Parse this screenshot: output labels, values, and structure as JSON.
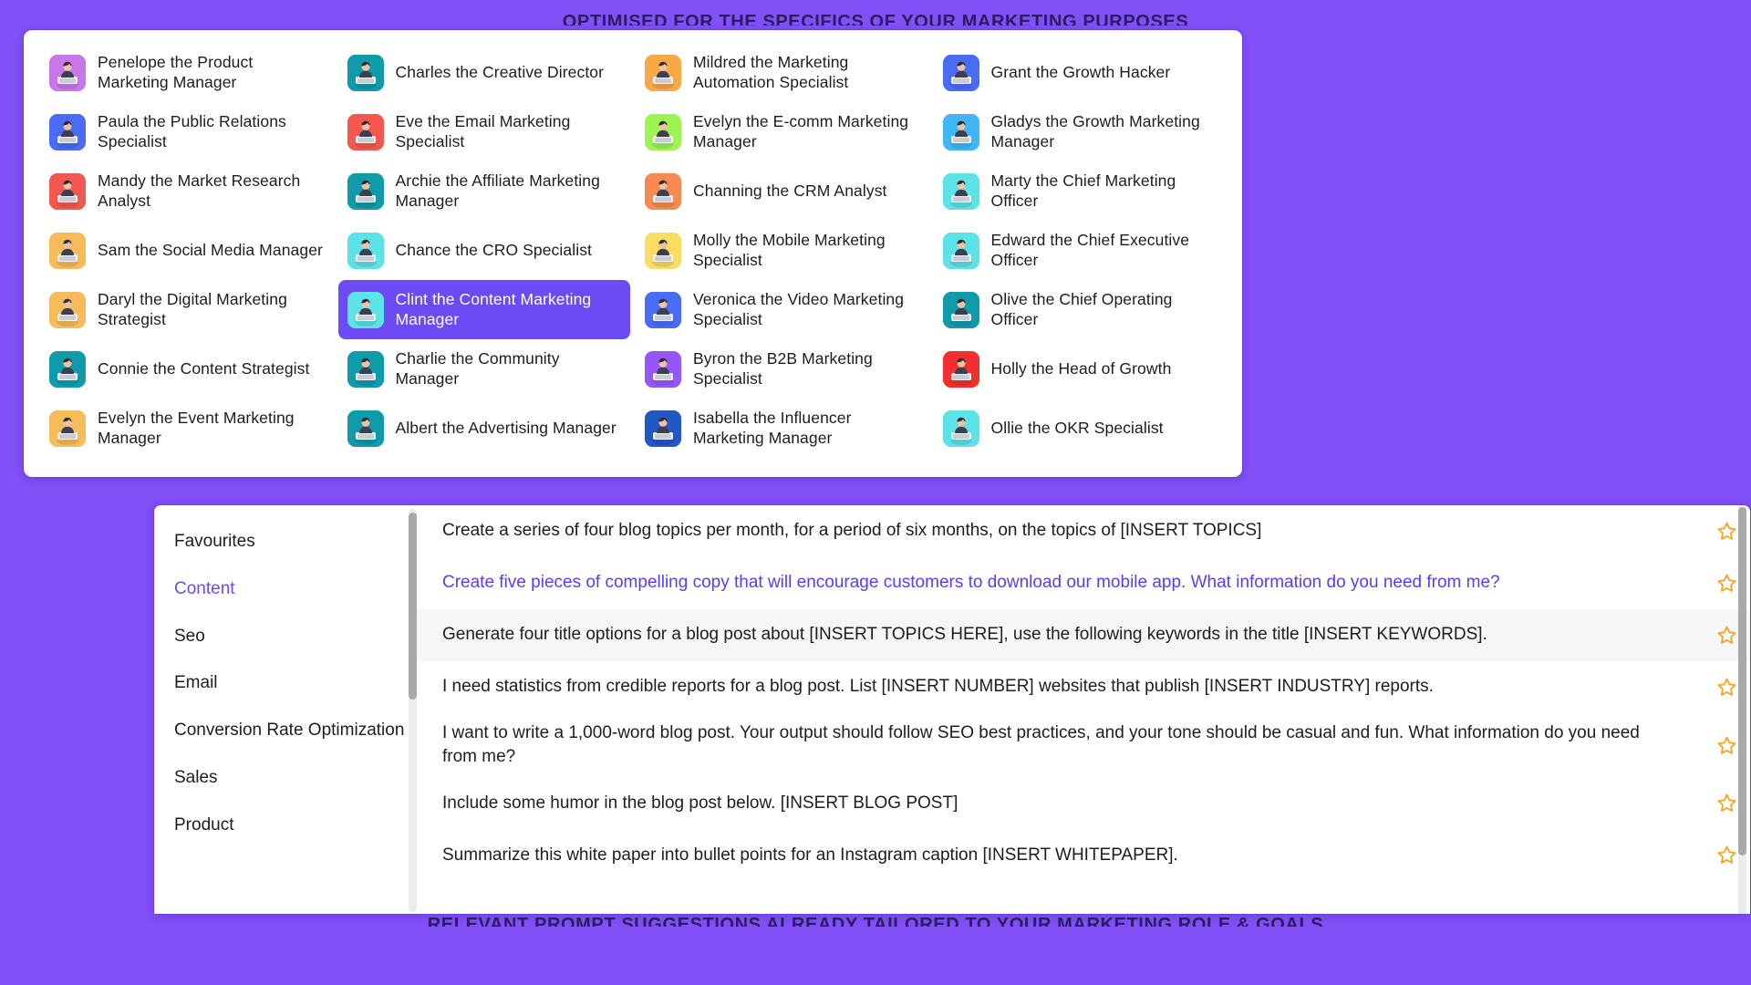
{
  "page": {
    "background_color": "#8250F7",
    "accent_color": "#6C4BF4",
    "star_color": "#F5A623",
    "headline_top": "OPTIMISED FOR THE SPECIFICS OF YOUR MARKETING PURPOSES",
    "headline_bottom": "RELEVANT PROMPT SUGGESTIONS ALREADY TAILORED TO YOUR MARKETING ROLE & GOALS"
  },
  "persona_card": {
    "selected": "Clint the Content Marketing Manager",
    "columns": [
      {
        "items": [
          {
            "label": "Penelope the Product Marketing Manager",
            "avatar": "avatar-female-laptop",
            "color": "#C977E8",
            "selected": false
          },
          {
            "label": "Paula the Public Relations Specialist",
            "avatar": "avatar-female-desk",
            "color": "#4A6CF5",
            "selected": false
          },
          {
            "label": "Mandy the Market Research Analyst",
            "avatar": "avatar-female-phone",
            "color": "#F4574F",
            "selected": false
          },
          {
            "label": "Sam the Social Media Manager",
            "avatar": "avatar-male-laptop",
            "color": "#F8BB5C",
            "selected": false
          },
          {
            "label": "Daryl the Digital Marketing Strategist",
            "avatar": "avatar-male-desk",
            "color": "#F8BB5C",
            "selected": false
          },
          {
            "label": "Connie the Content Strategist",
            "avatar": "avatar-female-board",
            "color": "#0F9BAA",
            "selected": false
          },
          {
            "label": "Evelyn the Event Marketing Manager",
            "avatar": "avatar-female-event",
            "color": "#F8BB5C",
            "selected": false
          }
        ]
      },
      {
        "items": [
          {
            "label": "Charles the Creative Director",
            "avatar": "avatar-male-table",
            "color": "#0F9BAA",
            "selected": false
          },
          {
            "label": "Eve the Email Marketing Specialist",
            "avatar": "avatar-female-email",
            "color": "#F4574F",
            "selected": false
          },
          {
            "label": "Archie the Affiliate Marketing Manager",
            "avatar": "avatar-male-suit",
            "color": "#0F9BAA",
            "selected": false
          },
          {
            "label": "Chance the CRO Specialist",
            "avatar": "avatar-person-sitting",
            "color": "#5BE3E8",
            "selected": false
          },
          {
            "label": "Clint the Content Marketing Manager",
            "avatar": "avatar-presenter",
            "color": "#5BE3E8",
            "selected": true
          },
          {
            "label": "Charlie the Community Manager",
            "avatar": "avatar-male-community",
            "color": "#0F9BAA",
            "selected": false
          },
          {
            "label": "Albert the Advertising Manager",
            "avatar": "avatar-male-ads",
            "color": "#0F9BAA",
            "selected": false
          }
        ]
      },
      {
        "items": [
          {
            "label": "Mildred the Marketing Automation Specialist",
            "avatar": "avatar-female-dashboard",
            "color": "#F7A948",
            "selected": false
          },
          {
            "label": "Evelyn the E-comm Marketing Manager",
            "avatar": "avatar-female-ecomm",
            "color": "#9CF553",
            "selected": false
          },
          {
            "label": "Channing the CRM Analyst",
            "avatar": "avatar-male-crm",
            "color": "#F58B52",
            "selected": false
          },
          {
            "label": "Molly the Mobile Marketing Specialist",
            "avatar": "avatar-female-mobile",
            "color": "#FBDC65",
            "selected": false
          },
          {
            "label": "Veronica the Video Marketing Specialist",
            "avatar": "avatar-female-video",
            "color": "#4A6CF5",
            "selected": false
          },
          {
            "label": "Byron the B2B Marketing Specialist",
            "avatar": "avatar-male-b2b",
            "color": "#9456F5",
            "selected": false
          },
          {
            "label": "Isabella the Influencer Marketing Manager",
            "avatar": "avatar-female-influencer",
            "color": "#2258C4",
            "selected": false
          }
        ]
      },
      {
        "items": [
          {
            "label": "Grant the Growth Hacker",
            "avatar": "avatar-hacker",
            "color": "#4A6CF5",
            "selected": false
          },
          {
            "label": "Gladys the Growth Marketing Manager",
            "avatar": "avatar-female-growth",
            "color": "#3FB6F5",
            "selected": false
          },
          {
            "label": "Marty the Chief Marketing Officer",
            "avatar": "avatar-male-cheer",
            "color": "#5BE3E8",
            "selected": false
          },
          {
            "label": "Edward the Chief Executive Officer",
            "avatar": "avatar-ceo-podium",
            "color": "#5BE3E8",
            "selected": false
          },
          {
            "label": "Olive the Chief Operating Officer",
            "avatar": "avatar-female-coo",
            "color": "#0F9BAA",
            "selected": false
          },
          {
            "label": "Holly the Head of Growth",
            "avatar": "avatar-female-growth-wall",
            "color": "#F22E2E",
            "selected": false
          },
          {
            "label": "Ollie the OKR Specialist",
            "avatar": "avatar-okr-desk",
            "color": "#5BE3E8",
            "selected": false
          }
        ]
      }
    ]
  },
  "prompt_panel": {
    "categories": [
      {
        "label": "Favourites",
        "active": false
      },
      {
        "label": "Content",
        "active": true
      },
      {
        "label": "Seo",
        "active": false
      },
      {
        "label": "Email",
        "active": false
      },
      {
        "label": "Conversion Rate Optimization",
        "active": false
      },
      {
        "label": "Sales",
        "active": false
      },
      {
        "label": "Product",
        "active": false
      }
    ],
    "prompts": [
      {
        "text": "Create a series of four blog topics per month, for a period of six months, on the topics of [INSERT TOPICS]",
        "highlight": false,
        "hovered": false,
        "starred": false
      },
      {
        "text": "Create five pieces of compelling copy that will encourage customers to download our mobile app. What information do you need from me?",
        "highlight": true,
        "hovered": false,
        "starred": false
      },
      {
        "text": "Generate four title options for a blog post about [INSERT TOPICS HERE], use the following keywords in the title [INSERT KEYWORDS].",
        "highlight": false,
        "hovered": true,
        "starred": false
      },
      {
        "text": "I need statistics from credible reports for a blog post. List [INSERT NUMBER] websites that publish [INSERT INDUSTRY] reports.",
        "highlight": false,
        "hovered": false,
        "starred": false
      },
      {
        "text": "I want to write a 1,000-word blog post. Your output should follow SEO best practices, and your tone should be casual and fun. What information do you need from me?",
        "highlight": false,
        "hovered": false,
        "starred": false
      },
      {
        "text": "Include some humor in the blog post below. [INSERT BLOG POST]",
        "highlight": false,
        "hovered": false,
        "starred": false
      },
      {
        "text": "Summarize this white paper into bullet points for an Instagram caption [INSERT WHITEPAPER].",
        "highlight": false,
        "hovered": false,
        "starred": false
      }
    ],
    "star_icon": "star-outline-icon"
  }
}
